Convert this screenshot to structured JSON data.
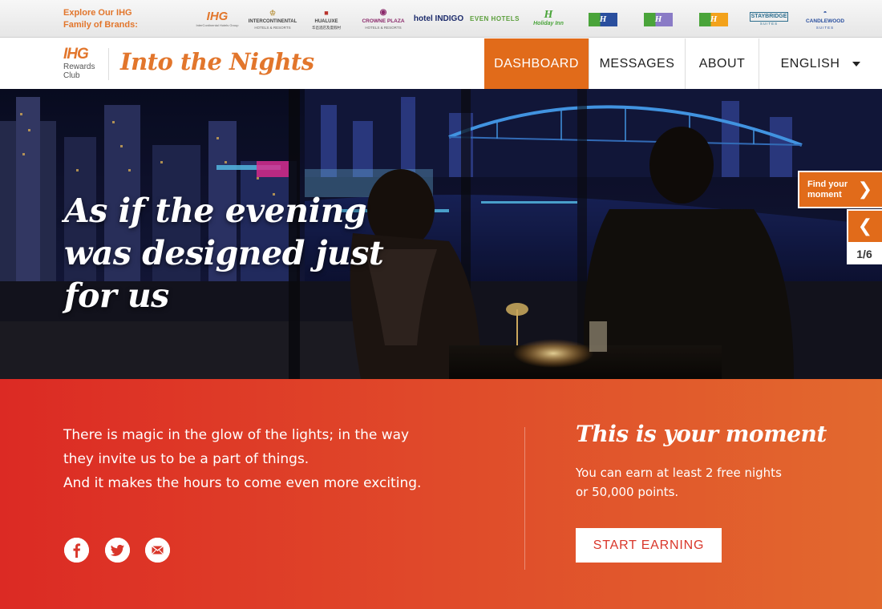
{
  "brandbar": {
    "explore_label": "Explore Our IHG\nFamily of Brands:",
    "brands": [
      {
        "name": "IHG",
        "sub": "InterContinental Hotels Group"
      },
      {
        "name": "INTERCONTINENTAL",
        "sub": "HOTELS & RESORTS"
      },
      {
        "name": "HUALUXE",
        "sub": "华邑酒店及度假村"
      },
      {
        "name": "CROWNE PLAZA",
        "sub": "HOTELS & RESORTS"
      },
      {
        "name": "hotel INDIGO",
        "sub": ""
      },
      {
        "name": "EVEN HOTELS",
        "sub": ""
      },
      {
        "name": "Holiday Inn",
        "sub": ""
      },
      {
        "name": "Holiday Inn Express",
        "sub": ""
      },
      {
        "name": "Holiday Inn Resort",
        "sub": ""
      },
      {
        "name": "Holiday Inn Club Vacations",
        "sub": ""
      },
      {
        "name": "STAYBRIDGE",
        "sub": "SUITES"
      },
      {
        "name": "CANDLEWOOD",
        "sub": "SUITES"
      }
    ]
  },
  "header": {
    "logo_main": "IHG",
    "logo_sub_1": "Rewards",
    "logo_sub_2": "Club",
    "site_title": "Into the Nights",
    "nav": {
      "dashboard": "DASHBOARD",
      "messages": "MESSAGES",
      "about": "ABOUT",
      "language": "ENGLISH"
    }
  },
  "hero": {
    "headline": "As if the evening was designed just for us",
    "find_moment": "Find your moment",
    "next_glyph": "❯",
    "prev_glyph": "❮",
    "counter": "1/6"
  },
  "bottom": {
    "intro_lines": [
      "There is magic in the glow of the lights; in the way",
      "they invite us to be a part of things.",
      "And it makes the hours to come even more exciting."
    ],
    "moment_title": "This is your moment",
    "moment_lines": [
      "You can earn at least 2 free nights",
      "or 50,000 points."
    ],
    "cta": "START EARNING"
  },
  "colors": {
    "brand_orange": "#e16b1a",
    "title_orange": "#e2762c",
    "panel_red": "#dc2a24",
    "panel_orange": "#e2692e"
  },
  "icons": [
    "facebook-icon",
    "twitter-icon",
    "email-icon",
    "chevron-right-icon",
    "chevron-left-icon",
    "chevron-down-icon"
  ]
}
